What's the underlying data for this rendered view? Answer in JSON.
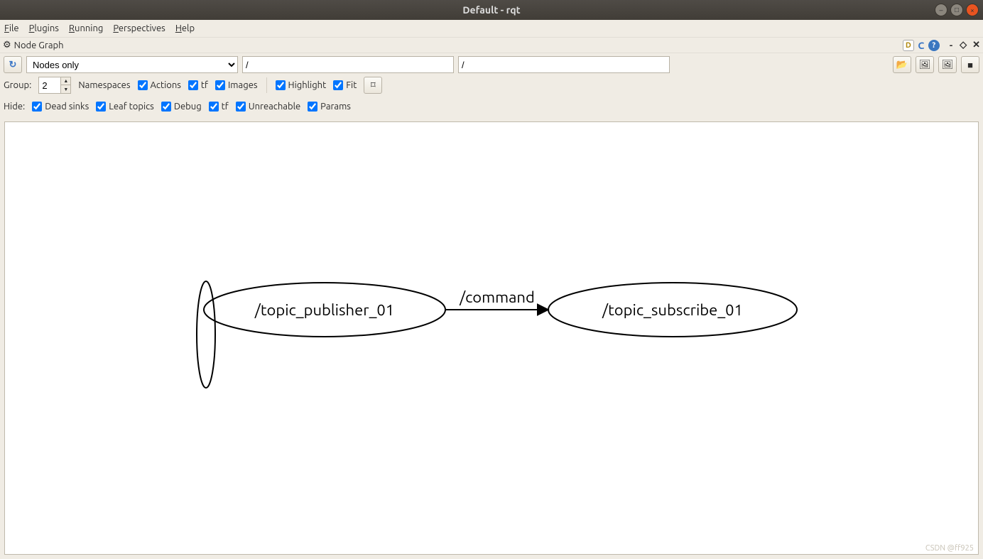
{
  "window": {
    "title": "Default - rqt"
  },
  "menubar": {
    "file": "File",
    "plugins": "Plugins",
    "running": "Running",
    "perspectives": "Perspectives",
    "help": "Help"
  },
  "panel": {
    "title": "Node Graph"
  },
  "header_icons": {
    "d": "D",
    "c": "C",
    "q": "?"
  },
  "toolbar": {
    "refresh_glyph": "↻",
    "mode_options": [
      "Nodes only"
    ],
    "mode_selected": "Nodes only",
    "filter1": "/",
    "filter2": "/",
    "right_icons": [
      "open-folder",
      "save-image-1",
      "save-image-2",
      "window-square"
    ]
  },
  "group_row": {
    "group_label": "Group:",
    "group_value": "2",
    "namespaces_label": "Namespaces",
    "actions": "Actions",
    "tf1": "tf",
    "images": "Images",
    "highlight": "Highlight",
    "fit": "Fit",
    "fit_btn_glyph": "⌑"
  },
  "hide_row": {
    "hide_label": "Hide:",
    "dead": "Dead sinks",
    "leaf": "Leaf topics",
    "debug": "Debug",
    "tf2": "tf",
    "unreach": "Unreachable",
    "params": "Params"
  },
  "graph": {
    "publisher": "/topic_publisher_01",
    "subscriber": "/topic_subscribe_01",
    "edge_label": "/command"
  },
  "chart_data": {
    "type": "graph",
    "nodes": [
      {
        "id": "n1",
        "label": "/topic_publisher_01"
      },
      {
        "id": "n2",
        "label": "/topic_subscribe_01"
      }
    ],
    "edges": [
      {
        "from": "n1",
        "to": "n2",
        "label": "/command"
      }
    ]
  },
  "watermark": "CSDN @ff925"
}
